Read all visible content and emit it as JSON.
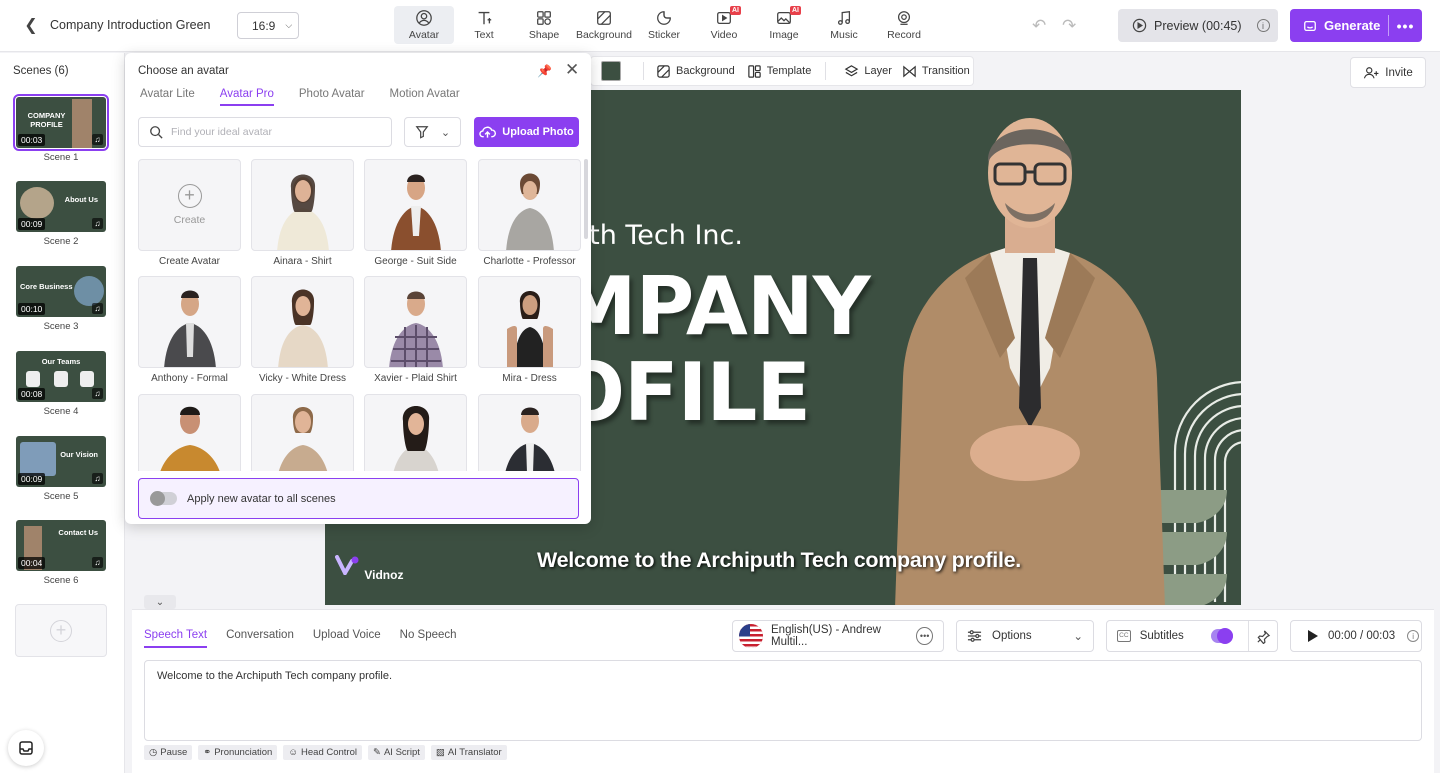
{
  "header": {
    "project_title": "Company Introduction Green",
    "aspect_ratio": "16:9",
    "tools": [
      {
        "label": "Avatar",
        "icon": "avatar-icon",
        "ai": false,
        "active": true
      },
      {
        "label": "Text",
        "icon": "text-icon",
        "ai": false
      },
      {
        "label": "Shape",
        "icon": "shape-icon",
        "ai": false
      },
      {
        "label": "Background",
        "icon": "background-icon",
        "ai": false
      },
      {
        "label": "Sticker",
        "icon": "sticker-icon",
        "ai": false
      },
      {
        "label": "Video",
        "icon": "video-icon",
        "ai": true
      },
      {
        "label": "Image",
        "icon": "image-icon",
        "ai": true
      },
      {
        "label": "Music",
        "icon": "music-icon",
        "ai": false
      },
      {
        "label": "Record",
        "icon": "record-icon",
        "ai": false
      }
    ],
    "ai_badge": "AI",
    "preview_label": "Preview (00:45)",
    "generate_label": "Generate"
  },
  "scenes": {
    "title": "Scenes (6)",
    "items": [
      {
        "label": "Scene 1",
        "duration": "00:03",
        "thumb_text": "COMPANY PROFILE"
      },
      {
        "label": "Scene 2",
        "duration": "00:09",
        "thumb_text": "About Us"
      },
      {
        "label": "Scene 3",
        "duration": "00:10",
        "thumb_text": "Core Business"
      },
      {
        "label": "Scene 4",
        "duration": "00:08",
        "thumb_text": "Our Teams"
      },
      {
        "label": "Scene 5",
        "duration": "00:09",
        "thumb_text": "Our Vision"
      },
      {
        "label": "Scene 6",
        "duration": "00:04",
        "thumb_text": "Contact Us"
      }
    ]
  },
  "canvas_toolbar": {
    "background": "Background",
    "template": "Template",
    "layer": "Layer",
    "transition": "Transition",
    "swatch_color": "#3c4f41"
  },
  "invite_label": "Invite",
  "canvas": {
    "small_title": "uth Tech Inc.",
    "big_line1": "MPANY",
    "big_line2": "OFILE",
    "subtitle": "Welcome to the Archiputh Tech company profile.",
    "logo_text": "Vidnoz",
    "bg_color": "#3c4f41"
  },
  "avatar_popup": {
    "title": "Choose an avatar",
    "tabs": [
      "Avatar Lite",
      "Avatar Pro",
      "Photo Avatar",
      "Motion Avatar"
    ],
    "active_tab": 1,
    "search_placeholder": "Find your ideal avatar",
    "upload_label": "Upload Photo",
    "create_label": "Create",
    "avatars": [
      {
        "name": "Create Avatar"
      },
      {
        "name": "Ainara - Shirt"
      },
      {
        "name": "George - Suit Side"
      },
      {
        "name": "Charlotte - Professor"
      },
      {
        "name": "Anthony - Formal"
      },
      {
        "name": "Vicky - White Dress"
      },
      {
        "name": "Xavier - Plaid Shirt"
      },
      {
        "name": "Mira - Dress"
      }
    ],
    "apply_label": "Apply new avatar to all scenes"
  },
  "speech": {
    "tabs": [
      "Speech Text",
      "Conversation",
      "Upload Voice",
      "No Speech"
    ],
    "active_tab": 0,
    "voice_label": "English(US) - Andrew Multil...",
    "options_label": "Options",
    "subtitles_label": "Subtitles",
    "time_label": "00:00 / 00:03",
    "text": "Welcome to the Archiputh Tech company profile.",
    "chips": [
      "Pause",
      "Pronunciation",
      "Head Control",
      "AI Script",
      "AI Translator"
    ]
  }
}
